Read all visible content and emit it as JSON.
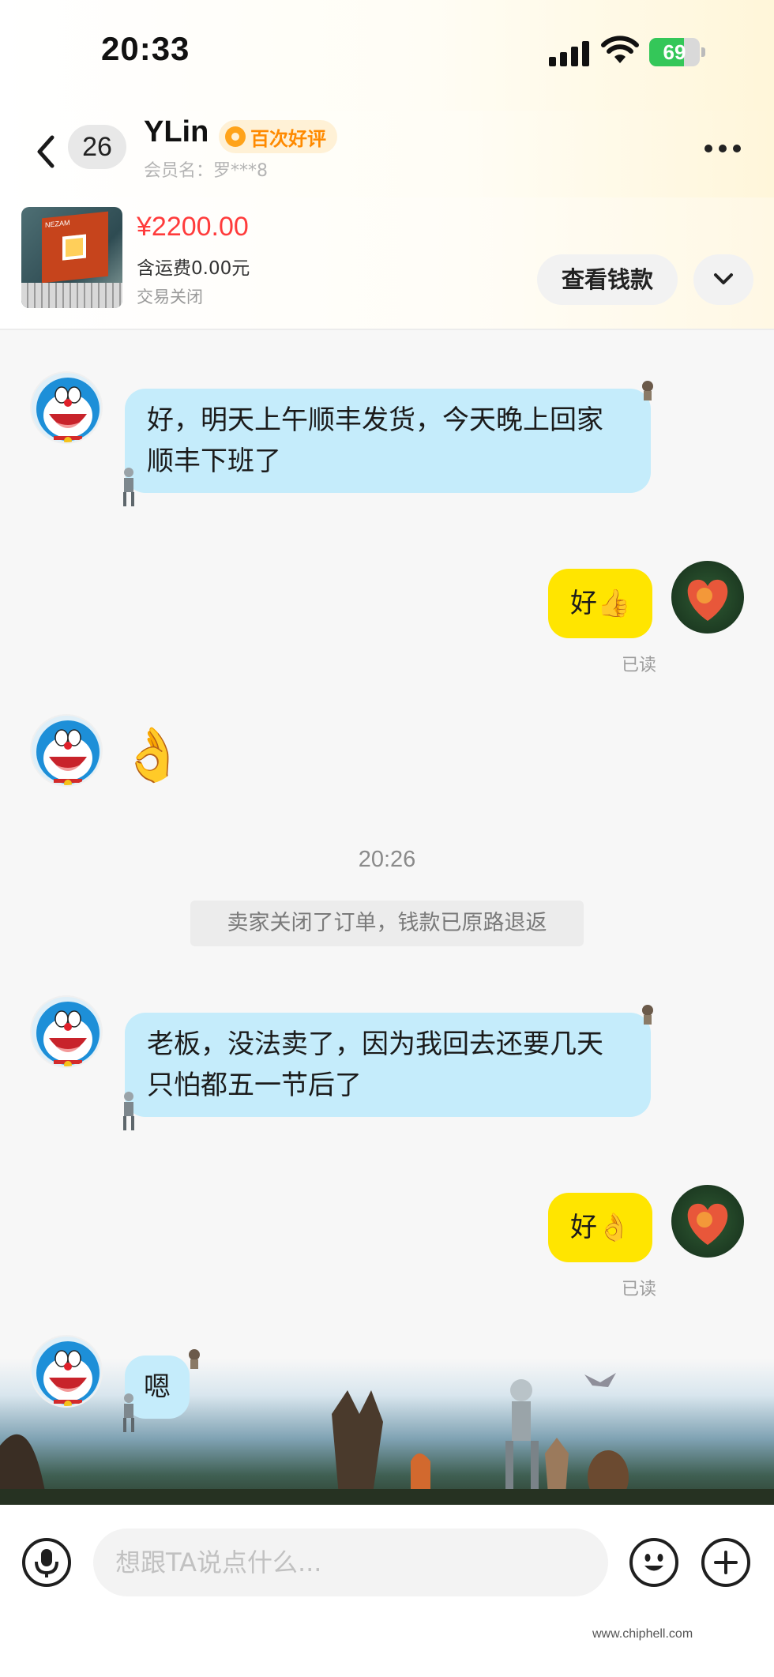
{
  "status_bar": {
    "time": "20:33",
    "battery_level": "69",
    "battery_fraction": 0.69,
    "battery_color": "#34c759"
  },
  "header": {
    "back_icon": "chevron-left-icon",
    "unread_count": "26",
    "contact_name": "YLin",
    "review_badge": "百次好评",
    "member_name": "会员名：罗***8",
    "more_icon": "more-horizontal-icon"
  },
  "product": {
    "thumbnail_caption": "NEZAM",
    "price": "¥2200.00",
    "shipping": "含运费0.00元",
    "status": "交易关闭",
    "view_payment_label": "查看钱款",
    "expand_icon": "chevron-down-icon"
  },
  "messages": [
    {
      "side": "left",
      "text": "好，明天上午顺丰发货，今天晚上回家顺丰下班了"
    },
    {
      "side": "right",
      "text": "好👍",
      "read": "已读"
    },
    {
      "side": "left",
      "text": "👌"
    },
    {
      "side": "left",
      "text": "老板，没法卖了，因为我回去还要几天只怕都五一节后了"
    },
    {
      "side": "right",
      "text": "好👌",
      "read": "已读"
    },
    {
      "side": "left",
      "text": "嗯"
    }
  ],
  "timestamp": "20:26",
  "system_notice": "卖家关闭了订单，钱款已原路退返",
  "input_bar": {
    "placeholder": "想跟TA说点什么...",
    "voice_icon": "microphone-icon",
    "emoji_icon": "smiley-icon",
    "plus_icon": "plus-circle-icon"
  },
  "watermark": "www.chiphell.com",
  "colors": {
    "seller_bubble": "#c5ecfb",
    "self_bubble": "#ffe500",
    "price": "#ff3b3b",
    "badge_orange": "#ff8a00"
  }
}
